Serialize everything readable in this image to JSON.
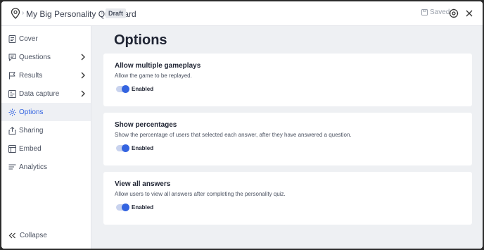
{
  "header": {
    "quiz_title": "My Big Personality Quiz Card",
    "status_badge": "Draft",
    "saved_label": "Saved"
  },
  "sidebar": {
    "items": [
      {
        "label": "Cover",
        "icon": "document-icon",
        "chevron": false,
        "active": false
      },
      {
        "label": "Questions",
        "icon": "chat-icon",
        "chevron": true,
        "active": false
      },
      {
        "label": "Results",
        "icon": "flag-icon",
        "chevron": true,
        "active": false
      },
      {
        "label": "Data capture",
        "icon": "form-icon",
        "chevron": true,
        "active": false
      },
      {
        "label": "Options",
        "icon": "gear-icon",
        "chevron": false,
        "active": true
      },
      {
        "label": "Sharing",
        "icon": "share-icon",
        "chevron": false,
        "active": false
      },
      {
        "label": "Embed",
        "icon": "embed-icon",
        "chevron": false,
        "active": false
      },
      {
        "label": "Analytics",
        "icon": "analytics-icon",
        "chevron": false,
        "active": false
      }
    ],
    "collapse_label": "Collapse"
  },
  "main": {
    "title": "Options",
    "options": [
      {
        "title": "Allow multiple gameplays",
        "description": "Allow the game to be replayed.",
        "toggle_label": "Enabled",
        "enabled": true
      },
      {
        "title": "Show percentages",
        "description": "Show the percentage of users that selected each answer, after they have answered a question.",
        "toggle_label": "Enabled",
        "enabled": true
      },
      {
        "title": "View all answers",
        "description": "Allow users to view all answers after completing the personality quiz.",
        "toggle_label": "Enabled",
        "enabled": true
      }
    ]
  },
  "colors": {
    "accent": "#3464e0",
    "toggle_track": "#c9d3ee",
    "main_bg": "#eef0f3",
    "active_nav_bg": "#eef0f4"
  }
}
